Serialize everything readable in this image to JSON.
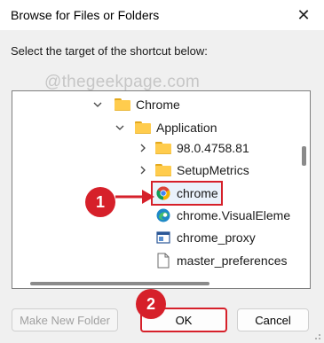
{
  "window": {
    "title": "Browse for Files or Folders",
    "close_glyph": "✕"
  },
  "prompt": "Select the target of the shortcut below:",
  "watermark": "@thegeekpage.com",
  "tree": [
    {
      "label": "Chrome",
      "icon": "folder-icon",
      "expander": "chevron-down-icon"
    },
    {
      "label": "Application",
      "icon": "folder-icon",
      "expander": "chevron-down-icon"
    },
    {
      "label": "98.0.4758.81",
      "icon": "folder-icon",
      "expander": "chevron-right-icon"
    },
    {
      "label": "SetupMetrics",
      "icon": "folder-icon",
      "expander": "chevron-right-icon"
    },
    {
      "label": "chrome",
      "icon": "chrome-icon",
      "selected": true
    },
    {
      "label": "chrome.VisualEleme",
      "icon": "edge-icon"
    },
    {
      "label": "chrome_proxy",
      "icon": "app-window-icon"
    },
    {
      "label": "master_preferences",
      "icon": "file-icon"
    }
  ],
  "buttons": {
    "new_folder": "Make New Folder",
    "ok": "OK",
    "cancel": "Cancel"
  },
  "badges": {
    "step1": "1",
    "step2": "2"
  },
  "colors": {
    "annotation_red": "#d6202a",
    "folder_yellow": "#ffcc4d"
  }
}
